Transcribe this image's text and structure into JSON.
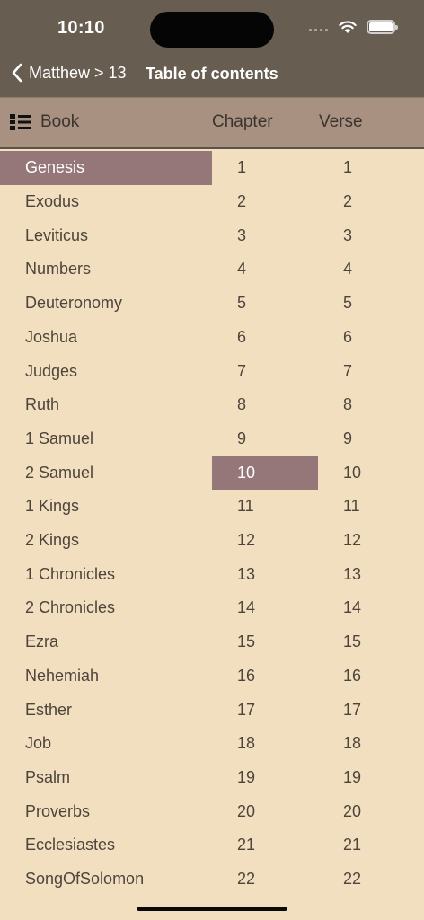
{
  "status": {
    "time": "10:10"
  },
  "nav": {
    "back_label": "Matthew > 13",
    "title": "Table of contents"
  },
  "header": {
    "book": "Book",
    "chapter": "Chapter",
    "verse": "Verse"
  },
  "books": [
    "Genesis",
    "Exodus",
    "Leviticus",
    "Numbers",
    "Deuteronomy",
    "Joshua",
    "Judges",
    "Ruth",
    "1 Samuel",
    "2 Samuel",
    "1 Kings",
    "2 Kings",
    "1 Chronicles",
    "2 Chronicles",
    "Ezra",
    "Nehemiah",
    "Esther",
    "Job",
    "Psalm",
    "Proverbs",
    "Ecclesiastes",
    "SongOfSolomon"
  ],
  "chapters": [
    "1",
    "2",
    "3",
    "4",
    "5",
    "6",
    "7",
    "8",
    "9",
    "10",
    "11",
    "12",
    "13",
    "14",
    "15",
    "16",
    "17",
    "18",
    "19",
    "20",
    "21",
    "22"
  ],
  "verses": [
    "1",
    "2",
    "3",
    "4",
    "5",
    "6",
    "7",
    "8",
    "9",
    "10",
    "11",
    "12",
    "13",
    "14",
    "15",
    "16",
    "17",
    "18",
    "19",
    "20",
    "21",
    "22"
  ],
  "selected": {
    "book_index": 0,
    "chapter_index": 9
  },
  "colors": {
    "nav_bg": "#675d50",
    "header_bg": "#a89180",
    "list_bg": "#f2dfbf",
    "selection": "#95777a",
    "text": "#4d443c"
  }
}
